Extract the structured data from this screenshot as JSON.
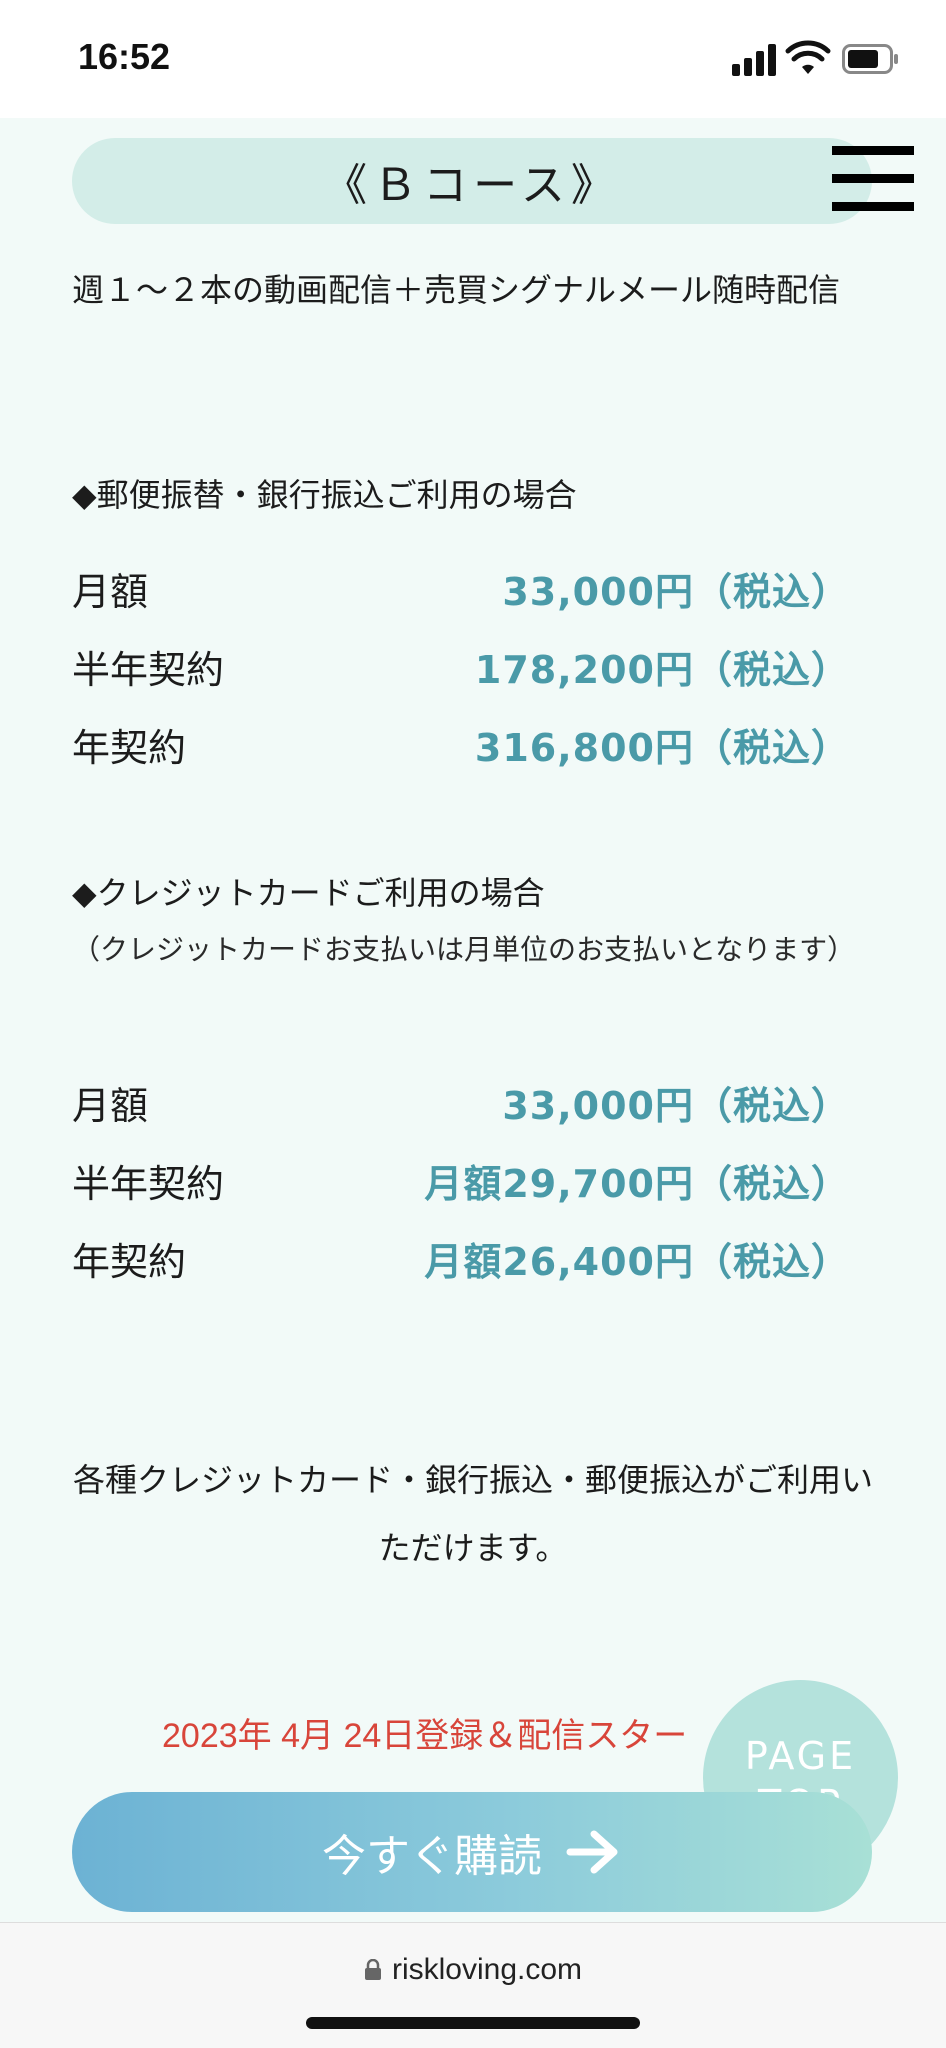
{
  "status_bar": {
    "time": "16:52"
  },
  "course": {
    "title": "《Ｂコース》"
  },
  "description": "週１〜２本の動画配信＋売買シグナルメール随時配信",
  "bank_section": {
    "heading": "◆郵便振替・銀行振込ご利用の場合",
    "rows": [
      {
        "label": "月額",
        "price": "33,000円（税込）"
      },
      {
        "label": "半年契約",
        "price": "178,200円（税込）"
      },
      {
        "label": "年契約",
        "price": "316,800円（税込）"
      }
    ]
  },
  "card_section": {
    "heading": "◆クレジットカードご利用の場合",
    "note": "（クレジットカードお支払いは月単位のお支払いとなります）",
    "rows": [
      {
        "label": "月額",
        "price": "33,000円（税込）"
      },
      {
        "label": "半年契約",
        "price": "月額29,700円（税込）"
      },
      {
        "label": "年契約",
        "price": "月額26,400円（税込）"
      }
    ]
  },
  "payment_note": "各種クレジットカード・銀行振込・郵便振込がご利用いただけます。",
  "start_date": "2023年 4月 24日登録＆配信スター",
  "page_top": {
    "label": "PAGE TOP"
  },
  "subscribe": {
    "label": "今すぐ購読"
  },
  "browser": {
    "url": "riskloving.com"
  },
  "colors": {
    "accent": "#4a9aa8",
    "pill": "#d3ede8",
    "date": "#d8453a"
  },
  "icons": [
    "menu-icon",
    "arrow-right-icon",
    "lock-icon",
    "signal-icon",
    "wifi-icon",
    "battery-icon"
  ]
}
